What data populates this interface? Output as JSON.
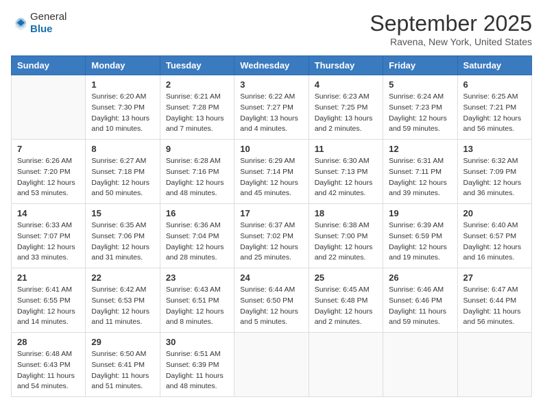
{
  "header": {
    "logo": {
      "text1": "General",
      "text2": "Blue"
    },
    "title": "September 2025",
    "location": "Ravena, New York, United States"
  },
  "weekdays": [
    "Sunday",
    "Monday",
    "Tuesday",
    "Wednesday",
    "Thursday",
    "Friday",
    "Saturday"
  ],
  "weeks": [
    [
      {
        "day": "",
        "sunrise": "",
        "sunset": "",
        "daylight": ""
      },
      {
        "day": "1",
        "sunrise": "Sunrise: 6:20 AM",
        "sunset": "Sunset: 7:30 PM",
        "daylight": "Daylight: 13 hours and 10 minutes."
      },
      {
        "day": "2",
        "sunrise": "Sunrise: 6:21 AM",
        "sunset": "Sunset: 7:28 PM",
        "daylight": "Daylight: 13 hours and 7 minutes."
      },
      {
        "day": "3",
        "sunrise": "Sunrise: 6:22 AM",
        "sunset": "Sunset: 7:27 PM",
        "daylight": "Daylight: 13 hours and 4 minutes."
      },
      {
        "day": "4",
        "sunrise": "Sunrise: 6:23 AM",
        "sunset": "Sunset: 7:25 PM",
        "daylight": "Daylight: 13 hours and 2 minutes."
      },
      {
        "day": "5",
        "sunrise": "Sunrise: 6:24 AM",
        "sunset": "Sunset: 7:23 PM",
        "daylight": "Daylight: 12 hours and 59 minutes."
      },
      {
        "day": "6",
        "sunrise": "Sunrise: 6:25 AM",
        "sunset": "Sunset: 7:21 PM",
        "daylight": "Daylight: 12 hours and 56 minutes."
      }
    ],
    [
      {
        "day": "7",
        "sunrise": "Sunrise: 6:26 AM",
        "sunset": "Sunset: 7:20 PM",
        "daylight": "Daylight: 12 hours and 53 minutes."
      },
      {
        "day": "8",
        "sunrise": "Sunrise: 6:27 AM",
        "sunset": "Sunset: 7:18 PM",
        "daylight": "Daylight: 12 hours and 50 minutes."
      },
      {
        "day": "9",
        "sunrise": "Sunrise: 6:28 AM",
        "sunset": "Sunset: 7:16 PM",
        "daylight": "Daylight: 12 hours and 48 minutes."
      },
      {
        "day": "10",
        "sunrise": "Sunrise: 6:29 AM",
        "sunset": "Sunset: 7:14 PM",
        "daylight": "Daylight: 12 hours and 45 minutes."
      },
      {
        "day": "11",
        "sunrise": "Sunrise: 6:30 AM",
        "sunset": "Sunset: 7:13 PM",
        "daylight": "Daylight: 12 hours and 42 minutes."
      },
      {
        "day": "12",
        "sunrise": "Sunrise: 6:31 AM",
        "sunset": "Sunset: 7:11 PM",
        "daylight": "Daylight: 12 hours and 39 minutes."
      },
      {
        "day": "13",
        "sunrise": "Sunrise: 6:32 AM",
        "sunset": "Sunset: 7:09 PM",
        "daylight": "Daylight: 12 hours and 36 minutes."
      }
    ],
    [
      {
        "day": "14",
        "sunrise": "Sunrise: 6:33 AM",
        "sunset": "Sunset: 7:07 PM",
        "daylight": "Daylight: 12 hours and 33 minutes."
      },
      {
        "day": "15",
        "sunrise": "Sunrise: 6:35 AM",
        "sunset": "Sunset: 7:06 PM",
        "daylight": "Daylight: 12 hours and 31 minutes."
      },
      {
        "day": "16",
        "sunrise": "Sunrise: 6:36 AM",
        "sunset": "Sunset: 7:04 PM",
        "daylight": "Daylight: 12 hours and 28 minutes."
      },
      {
        "day": "17",
        "sunrise": "Sunrise: 6:37 AM",
        "sunset": "Sunset: 7:02 PM",
        "daylight": "Daylight: 12 hours and 25 minutes."
      },
      {
        "day": "18",
        "sunrise": "Sunrise: 6:38 AM",
        "sunset": "Sunset: 7:00 PM",
        "daylight": "Daylight: 12 hours and 22 minutes."
      },
      {
        "day": "19",
        "sunrise": "Sunrise: 6:39 AM",
        "sunset": "Sunset: 6:59 PM",
        "daylight": "Daylight: 12 hours and 19 minutes."
      },
      {
        "day": "20",
        "sunrise": "Sunrise: 6:40 AM",
        "sunset": "Sunset: 6:57 PM",
        "daylight": "Daylight: 12 hours and 16 minutes."
      }
    ],
    [
      {
        "day": "21",
        "sunrise": "Sunrise: 6:41 AM",
        "sunset": "Sunset: 6:55 PM",
        "daylight": "Daylight: 12 hours and 14 minutes."
      },
      {
        "day": "22",
        "sunrise": "Sunrise: 6:42 AM",
        "sunset": "Sunset: 6:53 PM",
        "daylight": "Daylight: 12 hours and 11 minutes."
      },
      {
        "day": "23",
        "sunrise": "Sunrise: 6:43 AM",
        "sunset": "Sunset: 6:51 PM",
        "daylight": "Daylight: 12 hours and 8 minutes."
      },
      {
        "day": "24",
        "sunrise": "Sunrise: 6:44 AM",
        "sunset": "Sunset: 6:50 PM",
        "daylight": "Daylight: 12 hours and 5 minutes."
      },
      {
        "day": "25",
        "sunrise": "Sunrise: 6:45 AM",
        "sunset": "Sunset: 6:48 PM",
        "daylight": "Daylight: 12 hours and 2 minutes."
      },
      {
        "day": "26",
        "sunrise": "Sunrise: 6:46 AM",
        "sunset": "Sunset: 6:46 PM",
        "daylight": "Daylight: 11 hours and 59 minutes."
      },
      {
        "day": "27",
        "sunrise": "Sunrise: 6:47 AM",
        "sunset": "Sunset: 6:44 PM",
        "daylight": "Daylight: 11 hours and 56 minutes."
      }
    ],
    [
      {
        "day": "28",
        "sunrise": "Sunrise: 6:48 AM",
        "sunset": "Sunset: 6:43 PM",
        "daylight": "Daylight: 11 hours and 54 minutes."
      },
      {
        "day": "29",
        "sunrise": "Sunrise: 6:50 AM",
        "sunset": "Sunset: 6:41 PM",
        "daylight": "Daylight: 11 hours and 51 minutes."
      },
      {
        "day": "30",
        "sunrise": "Sunrise: 6:51 AM",
        "sunset": "Sunset: 6:39 PM",
        "daylight": "Daylight: 11 hours and 48 minutes."
      },
      {
        "day": "",
        "sunrise": "",
        "sunset": "",
        "daylight": ""
      },
      {
        "day": "",
        "sunrise": "",
        "sunset": "",
        "daylight": ""
      },
      {
        "day": "",
        "sunrise": "",
        "sunset": "",
        "daylight": ""
      },
      {
        "day": "",
        "sunrise": "",
        "sunset": "",
        "daylight": ""
      }
    ]
  ]
}
